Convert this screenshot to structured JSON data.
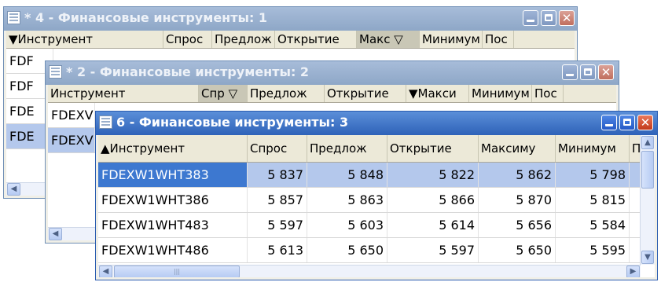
{
  "windows": {
    "w1": {
      "title": "* 4 - Финансовые инструменты: 1",
      "headers": [
        "▼Инструмент",
        "Спрос",
        "Предлож",
        "Открытие",
        "Макс ▽",
        "Минимум",
        "Пос"
      ],
      "rows": [
        "FDF",
        "FDF",
        "FDE",
        "FDE"
      ],
      "scroll_left": "◀"
    },
    "w2": {
      "title": "* 2 - Финансовые инструменты: 2",
      "headers": [
        "Инструмент",
        "Спр ▽",
        "Предлож",
        "Открытие",
        "▼Макси",
        "Минимум",
        "Пос"
      ],
      "rows": [
        "FDEXV",
        "FDEXV"
      ],
      "scroll_left": "◀"
    },
    "w3": {
      "title": "6 - Финансовые инструменты: 3",
      "headers": [
        "▲Инструмент",
        "Спрос",
        "Предлож",
        "Открытие",
        "Максиму",
        "Минимум",
        "П"
      ],
      "rows": [
        {
          "inst": "FDEXW1WHT383",
          "bid": "5 837",
          "ask": "5 848",
          "open": "5 822",
          "max": "5 862",
          "min": "5 798"
        },
        {
          "inst": "FDEXW1WHT386",
          "bid": "5 857",
          "ask": "5 863",
          "open": "5 866",
          "max": "5 870",
          "min": "5 815"
        },
        {
          "inst": "FDEXW1WHT483",
          "bid": "5 597",
          "ask": "5 603",
          "open": "5 614",
          "max": "5 656",
          "min": "5 584"
        },
        {
          "inst": "FDEXW1WHT486",
          "bid": "5 613",
          "ask": "5 650",
          "open": "5 597",
          "max": "5 650",
          "min": "5 595"
        }
      ],
      "scroll_up": "▲",
      "scroll_down": "▼",
      "scroll_left": "◀",
      "scroll_right": "▶",
      "thumb_grip": "|||"
    },
    "buttons": {
      "min": "",
      "max": "",
      "close": "✕"
    }
  },
  "colors": {
    "title_active": "#2e62b8",
    "title_inactive": "#8ea7c7",
    "selected_row": "#b4c8ec",
    "selected_cell": "#3d78d0"
  },
  "icons": [
    "window-icon",
    "minimize-icon",
    "maximize-icon",
    "close-icon",
    "sort-asc-icon",
    "sort-desc-icon",
    "filter-icon"
  ]
}
